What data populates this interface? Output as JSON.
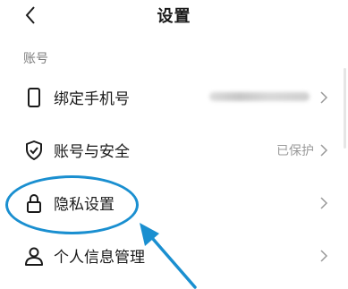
{
  "header": {
    "title": "设置",
    "back_icon": "chevron-left-icon"
  },
  "section": {
    "label": "账号"
  },
  "rows": [
    {
      "label": "绑定手机号",
      "icon": "phone-icon",
      "value": "",
      "value_blurred": true
    },
    {
      "label": "账号与安全",
      "icon": "shield-check-icon",
      "value": "已保护"
    },
    {
      "label": "隐私设置",
      "icon": "lock-icon",
      "value": ""
    },
    {
      "label": "个人信息管理",
      "icon": "person-icon",
      "value": ""
    }
  ],
  "colors": {
    "annotation": "#1a8fd0",
    "background": "#f1f1f1",
    "text": "#1a1a1a",
    "secondary_text": "#9a9a9a"
  }
}
